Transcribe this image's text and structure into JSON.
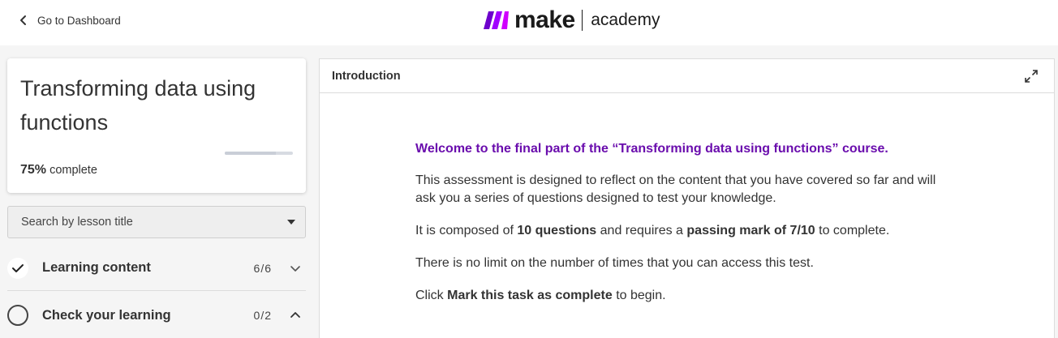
{
  "header": {
    "back_label": "Go to Dashboard",
    "logo_word": "make",
    "logo_sub": "academy",
    "logo_colors": [
      "#6d00cc",
      "#a100ff",
      "#d000ff"
    ]
  },
  "course": {
    "title": "Transforming data using functions",
    "progress_percent": "75%",
    "progress_suffix": "complete",
    "progress_value": 0.75
  },
  "search": {
    "placeholder": "Search by lesson title"
  },
  "sections": [
    {
      "label": "Learning content",
      "count": "6/6",
      "status": "complete",
      "chevron": "chevron-down-icon"
    },
    {
      "label": "Check your learning",
      "count": "0/2",
      "status": "incomplete",
      "chevron": "chevron-up-icon"
    }
  ],
  "panel": {
    "title": "Introduction",
    "headline": "Welcome to the final part of the “Transforming data using functions” course.",
    "p1": "This assessment is designed to reflect on the content that you have covered so far and will ask you a series of questions designed to test your knowledge.",
    "p2_a": "It is composed of ",
    "p2_b": "10 questions",
    "p2_c": " and requires a ",
    "p2_d": "passing mark of 7/10",
    "p2_e": " to complete.",
    "p3": "There is no limit on the number of times that you can access this test.",
    "p4_a": "Click ",
    "p4_b": "Mark this task as complete",
    "p4_c": " to begin.",
    "accent": "#6a0dad"
  }
}
